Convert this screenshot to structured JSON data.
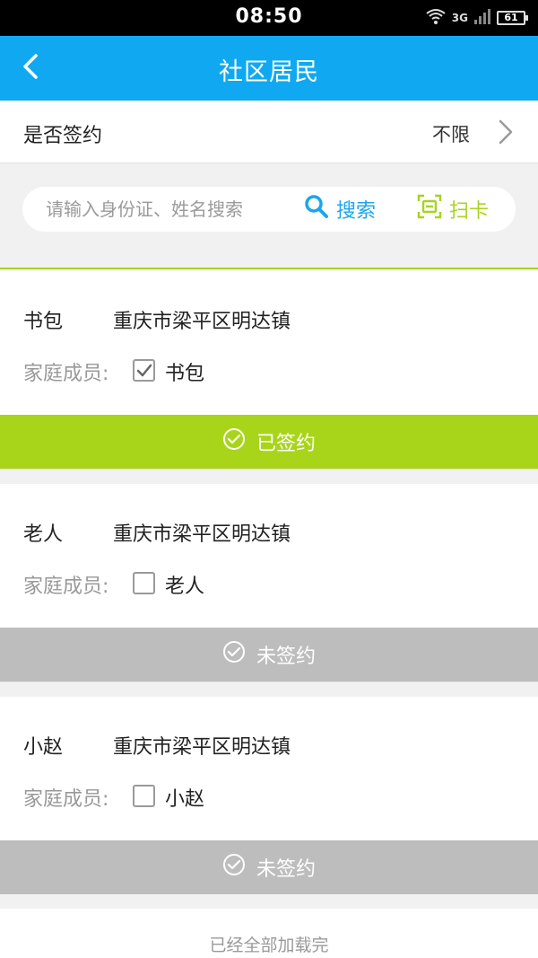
{
  "status_bar": {
    "time": "08:50",
    "network": "3G",
    "battery": "61",
    "icons": [
      "wifi-icon",
      "signal-icon",
      "battery-icon"
    ]
  },
  "nav": {
    "title": "社区居民",
    "back_icon": "chevron-left-icon"
  },
  "filter": {
    "label": "是否签约",
    "value": "不限"
  },
  "search": {
    "placeholder": "请输入身份证、姓名搜索",
    "search_label": "搜索",
    "card_label": "扫卡"
  },
  "residents": [
    {
      "name": "书包",
      "address": "重庆市梁平区明达镇",
      "family_label": "家庭成员:",
      "member": "书包",
      "member_checked": true,
      "status": "已签约"
    },
    {
      "name": "老人",
      "address": "重庆市梁平区明达镇",
      "family_label": "家庭成员:",
      "member": "老人",
      "member_checked": false,
      "status": "未签约"
    },
    {
      "name": "小赵",
      "address": "重庆市梁平区明达镇",
      "family_label": "家庭成员:",
      "member": "小赵",
      "member_checked": false,
      "status": "未签约"
    }
  ],
  "footer": {
    "text": "已经全部加载完"
  },
  "colors": {
    "nav_blue": "#10a9f1",
    "signed_green": "#a8d519",
    "unsigned_gray": "#bdbdbd",
    "search_blue": "#1ba6ee"
  }
}
